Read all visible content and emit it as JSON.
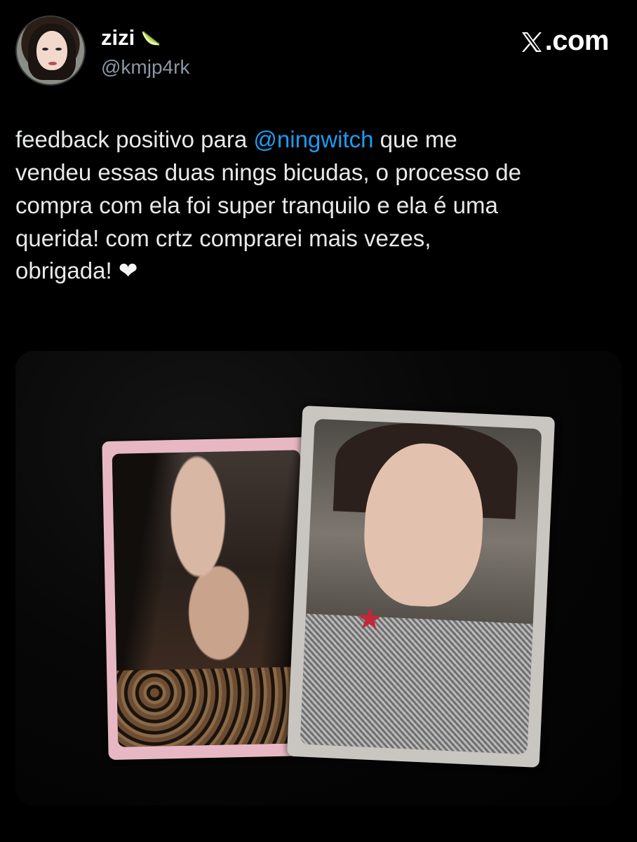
{
  "author": {
    "name": "zizi",
    "emoji": "lime-icon",
    "handle": "@kmjp4rk"
  },
  "site": {
    "label": ".com",
    "logo": "x-logo-icon"
  },
  "tweet": {
    "text_before": "feedback positivo para ",
    "mention": "@ningwitch",
    "text_after": " que me\nvendeu essas duas nings bicudas, o processo de\ncompra com ela foi super tranquilo e ela é uma\nquerida! com crtz comprarei mais vezes,\nobrigada! ",
    "heart": "❤"
  },
  "colors": {
    "background": "#000000",
    "text": "#e7e9ea",
    "mention": "#1d9bf0",
    "handle": "#8b98a5"
  },
  "media": {
    "icon": "photo-image"
  }
}
